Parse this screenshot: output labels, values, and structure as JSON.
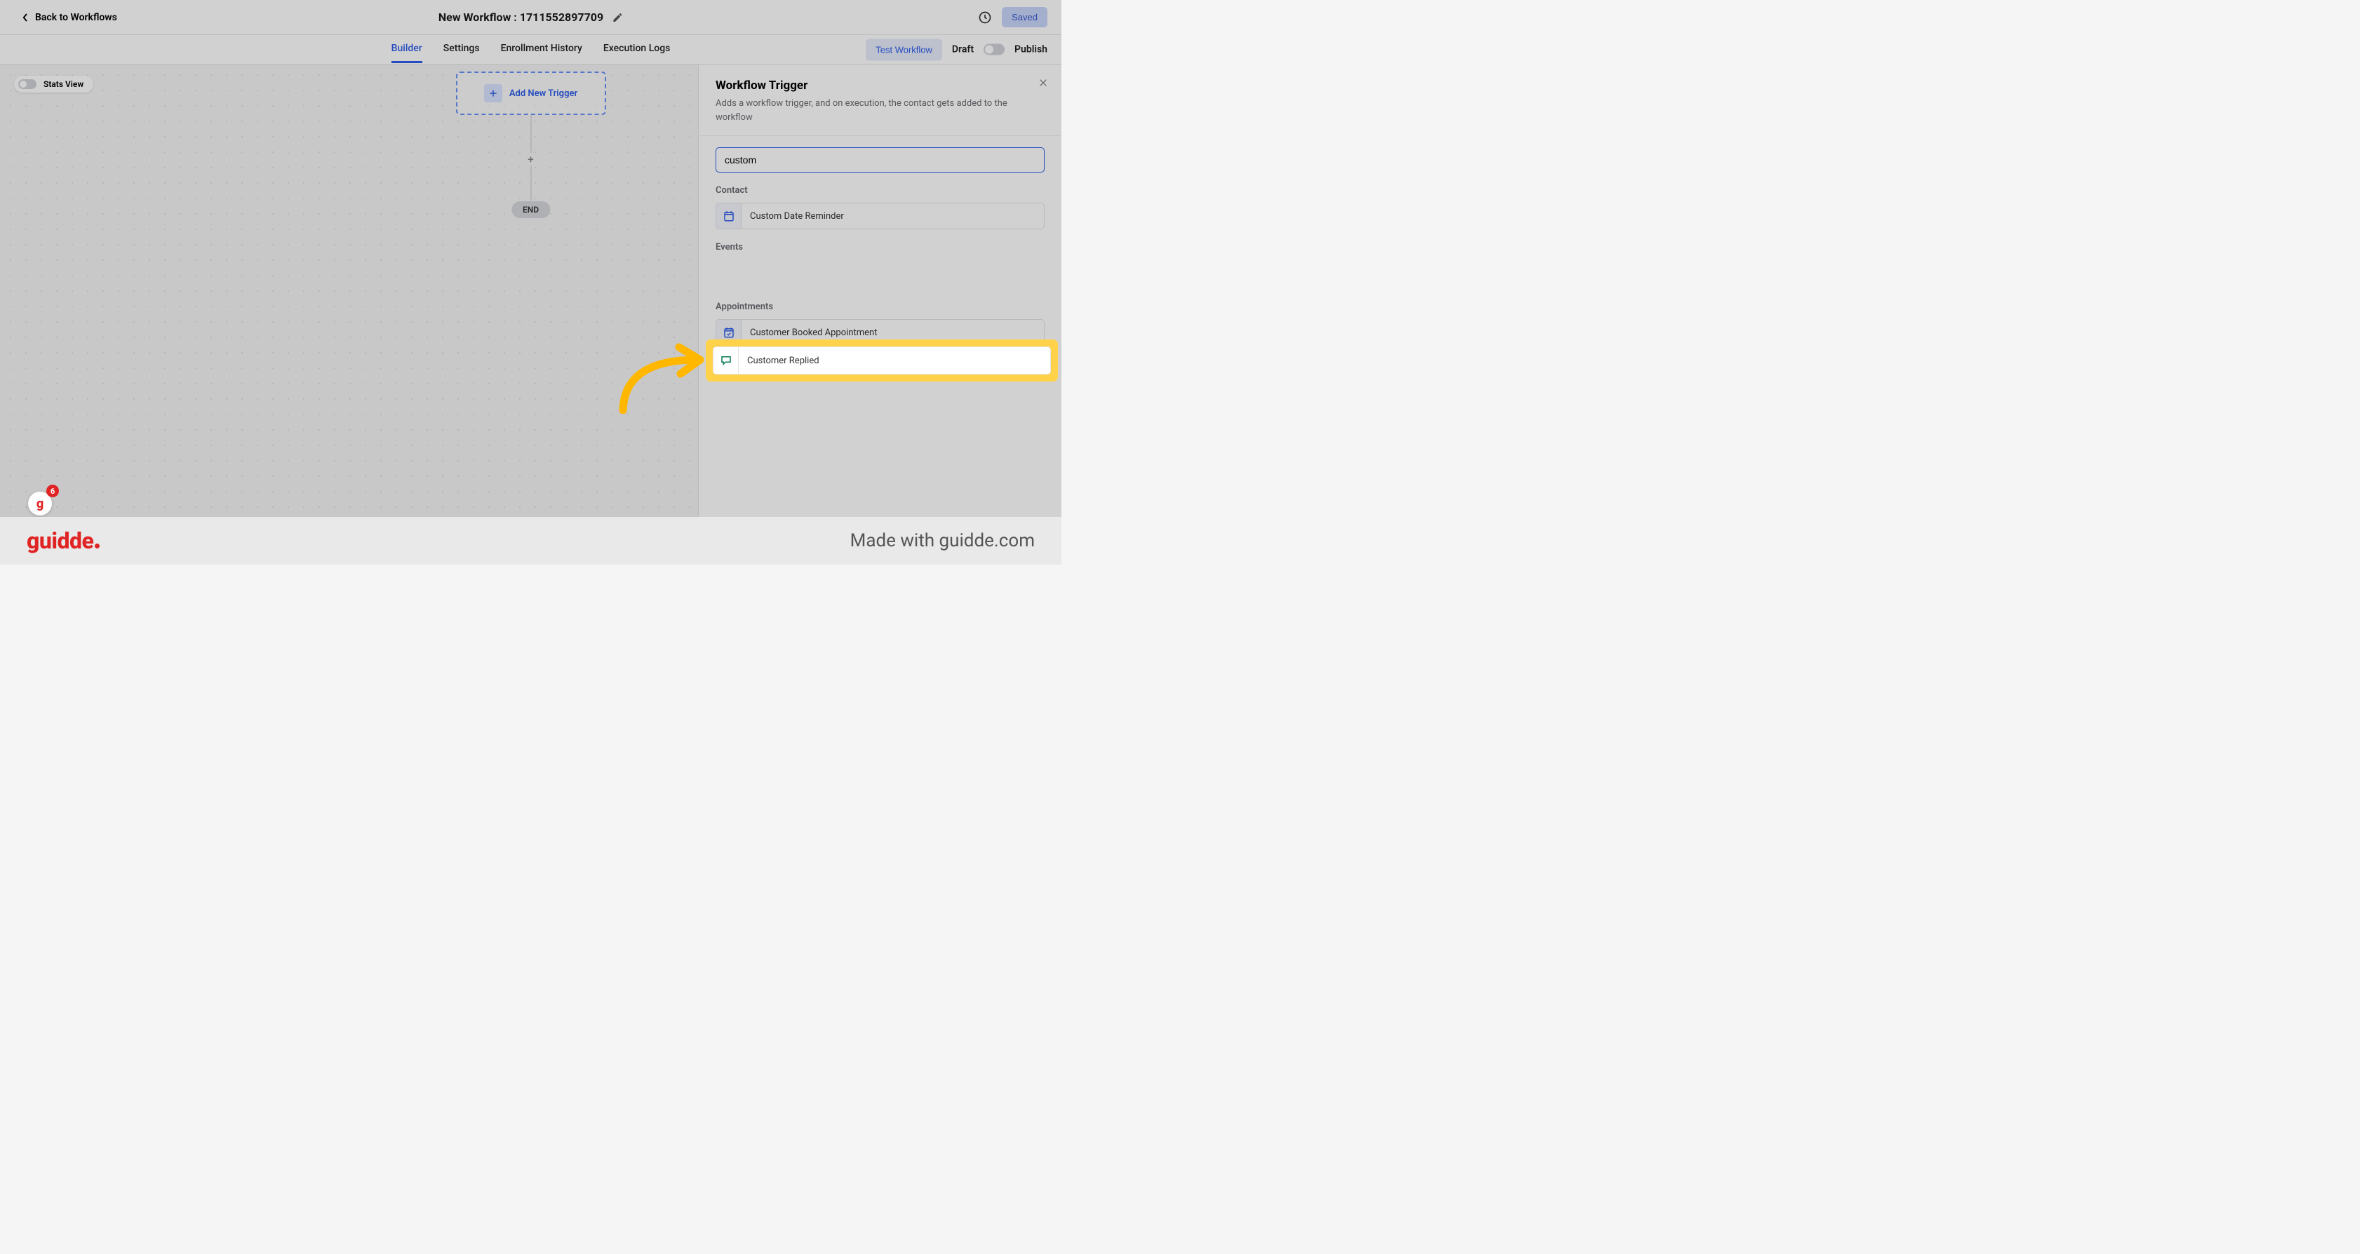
{
  "topbar": {
    "back_label": "Back to Workflows",
    "title": "New Workflow : 1711552897709",
    "saved_label": "Saved"
  },
  "tabs": {
    "builder": "Builder",
    "settings": "Settings",
    "enrollment": "Enrollment History",
    "execution": "Execution Logs",
    "test_label": "Test Workflow",
    "draft_label": "Draft",
    "publish_label": "Publish"
  },
  "canvas": {
    "stats_label": "Stats View",
    "add_trigger_label": "Add New Trigger",
    "end_label": "END"
  },
  "panel": {
    "title": "Workflow Trigger",
    "description": "Adds a workflow trigger, and on execution, the contact gets added to the workflow",
    "search_value": "custom",
    "categories": {
      "contact": {
        "label": "Contact",
        "items": [
          {
            "name": "Custom Date Reminder",
            "icon": "calendar"
          }
        ]
      },
      "events": {
        "label": "Events",
        "items": [
          {
            "name": "Customer Replied",
            "icon": "chat"
          }
        ]
      },
      "appointments": {
        "label": "Appointments",
        "items": [
          {
            "name": "Customer Booked Appointment",
            "icon": "calendar-check"
          }
        ]
      }
    }
  },
  "badge": {
    "count": "6"
  },
  "footer": {
    "brand": "guidde",
    "madewith": "Made with guidde.com"
  }
}
